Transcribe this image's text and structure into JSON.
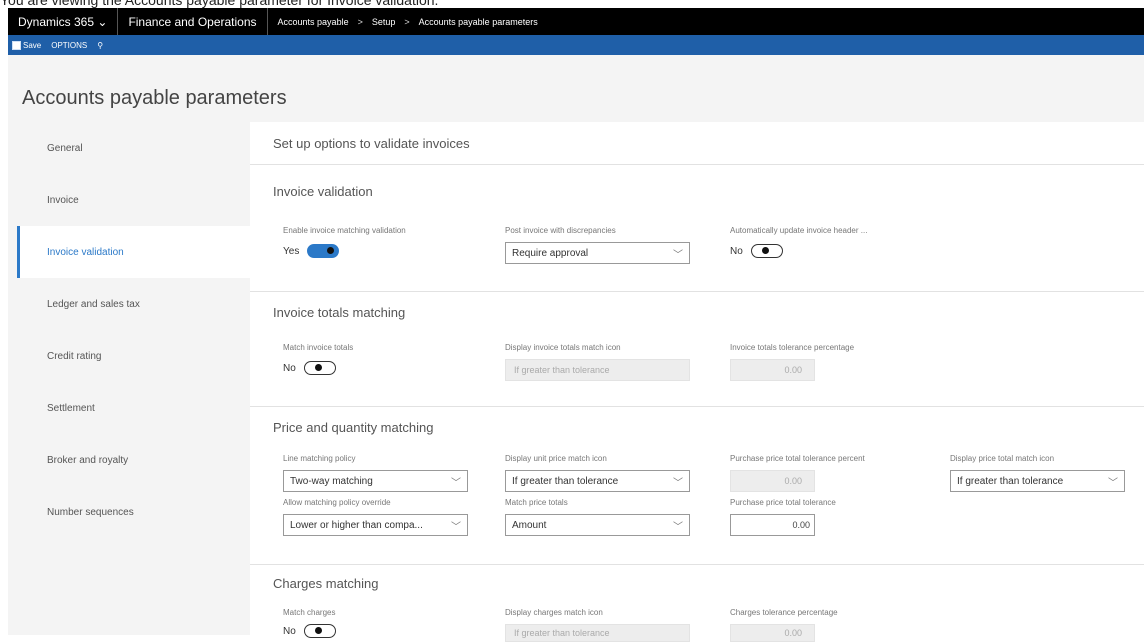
{
  "caption": "You are viewing the Accounts payable parameter for Invoice validation.",
  "topbar": {
    "app": "Dynamics 365",
    "module": "Finance and Operations",
    "breadcrumb": [
      "Accounts payable",
      "Setup",
      "Accounts payable parameters"
    ]
  },
  "actionbar": {
    "save": "Save",
    "options": "OPTIONS"
  },
  "page_title": "Accounts payable parameters",
  "sidebar": [
    {
      "label": "General"
    },
    {
      "label": "Invoice"
    },
    {
      "label": "Invoice validation"
    },
    {
      "label": "Ledger and sales tax"
    },
    {
      "label": "Credit rating"
    },
    {
      "label": "Settlement"
    },
    {
      "label": "Broker and royalty"
    },
    {
      "label": "Number sequences"
    }
  ],
  "content": {
    "header": "Set up options to validate invoices",
    "invoice_validation": {
      "title": "Invoice validation",
      "enable_label": "Enable invoice matching validation",
      "enable_value": "Yes",
      "post_label": "Post invoice with discrepancies",
      "post_value": "Require approval",
      "auto_label": "Automatically update invoice header ...",
      "auto_value": "No"
    },
    "totals": {
      "title": "Invoice totals matching",
      "match_label": "Match invoice totals",
      "match_value": "No",
      "icon_label": "Display invoice totals match icon",
      "icon_value": "If greater than tolerance",
      "tol_label": "Invoice totals tolerance percentage",
      "tol_value": "0.00"
    },
    "price_qty": {
      "title": "Price and quantity matching",
      "line_policy_label": "Line matching policy",
      "line_policy_value": "Two-way matching",
      "unit_icon_label": "Display unit price match icon",
      "unit_icon_value": "If greater than tolerance",
      "pct_label": "Purchase price total tolerance percent",
      "pct_value": "0.00",
      "total_icon_label": "Display price total match icon",
      "total_icon_value": "If greater than tolerance",
      "override_label": "Allow matching policy override",
      "override_value": "Lower or higher than compa...",
      "price_totals_label": "Match price totals",
      "price_totals_value": "Amount",
      "price_tol_label": "Purchase price total tolerance",
      "price_tol_value": "0.00"
    },
    "charges": {
      "title": "Charges matching",
      "match_label": "Match charges",
      "match_value": "No",
      "icon_label": "Display charges match icon",
      "icon_value": "If greater than tolerance",
      "tol_label": "Charges tolerance percentage",
      "tol_value": "0.00"
    }
  }
}
